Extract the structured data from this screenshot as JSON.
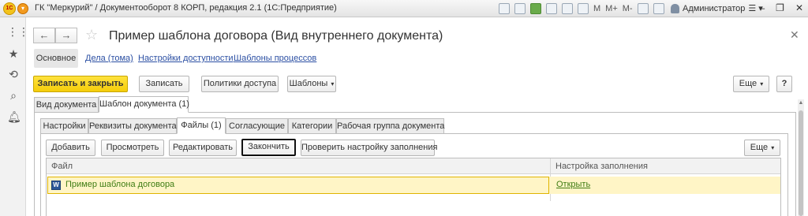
{
  "window": {
    "title": "ГК \"Меркурий\" / Документооборот 8 КОРП, редакция 2.1  (1С:Предприятие)",
    "user": "Администратор",
    "toolbar_labels": [
      "M",
      "M+",
      "M-"
    ]
  },
  "form": {
    "title": "Пример шаблона договора (Вид внутреннего документа)"
  },
  "links": {
    "main": "Основное",
    "items": [
      "Дела (тома)",
      "Настройки доступности",
      "Шаблоны процессов"
    ]
  },
  "toolbar": {
    "save_close": "Записать и закрыть",
    "save": "Записать",
    "access_policy": "Политики доступа",
    "templates": "Шаблоны",
    "more": "Еще",
    "help": "?"
  },
  "outer_tabs": [
    "Вид документа",
    "Шаблон документа (1)"
  ],
  "inner_tabs": [
    "Настройки",
    "Реквизиты документа",
    "Файлы (1)",
    "Согласующие",
    "Категории",
    "Рабочая группа документа"
  ],
  "files_toolbar": {
    "add": "Добавить",
    "view": "Просмотреть",
    "edit": "Редактировать",
    "finish": "Закончить",
    "check_fill": "Проверить настройку заполнения",
    "more": "Еще"
  },
  "table": {
    "columns": [
      "Файл",
      "Настройка заполнения"
    ],
    "rows": [
      {
        "file": "Пример шаблона договора",
        "setting": "Открыть"
      }
    ]
  },
  "colors": {
    "primary_button": "#f5cd0a",
    "selected_row": "#fff5c6",
    "row_text": "#3f7d14",
    "link": "#2b4fa3"
  }
}
